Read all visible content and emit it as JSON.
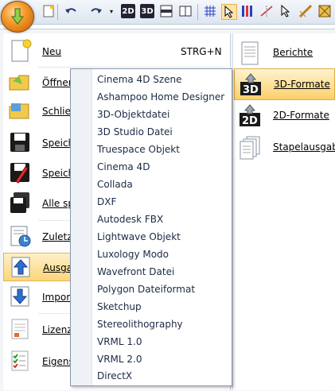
{
  "colors": {
    "accent_orange": "#f59a2a",
    "selection_gold": "#fbd67a",
    "pane_border": "#c8d0da"
  },
  "toolbar": {
    "icons": [
      "app-menu-orb",
      "new-page-icon",
      "undo-icon",
      "redo-icon",
      "2d-icon",
      "3d-icon",
      "floor-icon",
      "view-icon",
      "grid-icon",
      "cursor-icon",
      "columns-icon",
      "measure-icon",
      "select-icon",
      "wall-icon",
      "roof-icon"
    ],
    "label_2d": "2D",
    "label_3d": "3D"
  },
  "left_menu": {
    "items": [
      {
        "label": "Neu",
        "shortcut": "STRG+N",
        "icon": "new-document-icon"
      },
      {
        "label": "Öffner",
        "shortcut": "",
        "icon": "open-folder-icon"
      },
      {
        "label": "Schlie",
        "shortcut": "",
        "icon": "close-folder-icon"
      },
      {
        "label": "Speich",
        "shortcut": "",
        "icon": "save-icon"
      },
      {
        "label": "Speich",
        "shortcut": "",
        "icon": "save-as-icon"
      },
      {
        "label": "Alle sp",
        "shortcut": "",
        "icon": "save-all-icon"
      },
      {
        "label": "Zuletzt",
        "shortcut": "",
        "icon": "recent-icon"
      },
      {
        "label": "Ausga",
        "shortcut": "",
        "icon": "export-icon"
      },
      {
        "label": "Import",
        "shortcut": "",
        "icon": "import-icon"
      },
      {
        "label": "Lizenz",
        "shortcut": "",
        "icon": "license-icon"
      },
      {
        "label": "Eigens",
        "shortcut": "",
        "icon": "properties-icon"
      }
    ]
  },
  "right_menu": {
    "items": [
      {
        "label": "Berichte",
        "icon": "reports-icon"
      },
      {
        "label": "3D-Formate",
        "icon": "3d-formats-icon"
      },
      {
        "label": "2D-Formate",
        "icon": "2d-formats-icon"
      },
      {
        "label": "Stapelausgabe",
        "icon": "batch-export-icon"
      }
    ]
  },
  "submenu": {
    "items": [
      "Cinema 4D Szene",
      "Ashampoo Home Designer",
      "3D-Objektdatei",
      "3D Studio Datei",
      "Truespace Objekt",
      "Cinema 4D",
      "Collada",
      "DXF",
      "Autodesk FBX",
      "Lightwave Objekt",
      "Luxology Modo",
      "Wavefront Datei",
      "Polygon Dateiformat",
      "Sketchup",
      "Stereolithography",
      "VRML 1.0",
      "VRML 2.0",
      "DirectX"
    ]
  }
}
